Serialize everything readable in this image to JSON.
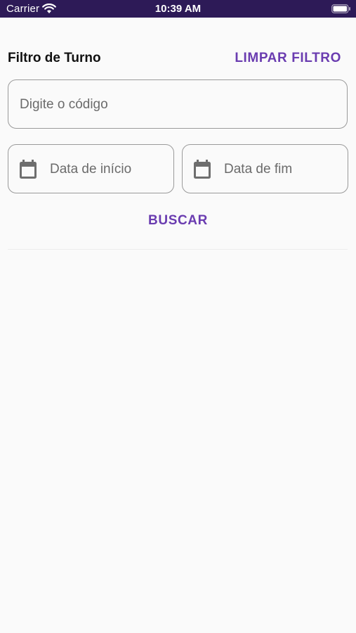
{
  "status_bar": {
    "carrier": "Carrier",
    "time": "10:39 AM",
    "background_color": "#2d1a57",
    "wifi_icon": "wifi-icon",
    "battery_icon": "battery-full-icon"
  },
  "header": {
    "title": "Filtro de Turno",
    "clear_filter_label": "LIMPAR FILTRO"
  },
  "filters": {
    "code_placeholder": "Digite o código",
    "start_date_placeholder": "Data de início",
    "end_date_placeholder": "Data de fim",
    "calendar_icon": "calendar-icon"
  },
  "actions": {
    "search_label": "BUSCAR"
  },
  "colors": {
    "accent": "#6a3cb0",
    "border": "#9a9a9a",
    "background": "#fafafa"
  }
}
